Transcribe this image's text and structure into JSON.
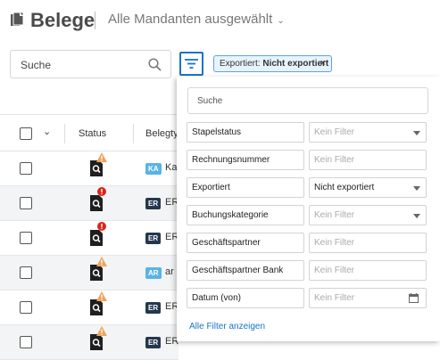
{
  "header": {
    "title": "Belege",
    "mandant_selector": "Alle Mandanten ausgewählt"
  },
  "toolbar": {
    "search_placeholder": "Suche",
    "active_filter_chip": {
      "label": "Exportiert:",
      "value": "Nicht exportiert",
      "remove": "×"
    }
  },
  "table": {
    "columns": [
      "Status",
      "Belegtyp"
    ],
    "rows": [
      {
        "status": "warning",
        "type_tag": "KA",
        "text": "Ka"
      },
      {
        "status": "error",
        "type_tag": "ER",
        "text": "ER"
      },
      {
        "status": "error",
        "type_tag": "ER",
        "text": "ER"
      },
      {
        "status": "warning",
        "type_tag": "AR",
        "text": "ar"
      },
      {
        "status": "warning",
        "type_tag": "ER",
        "text": "ER"
      },
      {
        "status": "warning",
        "type_tag": "ER",
        "text": "ER"
      }
    ]
  },
  "filter_panel": {
    "search_placeholder": "Suche",
    "filters": [
      {
        "label": "Stapelstatus",
        "value": "Kein Filter",
        "control": "dropdown",
        "active": false
      },
      {
        "label": "Rechnungsnummer",
        "value": "Kein Filter",
        "control": "text",
        "active": false
      },
      {
        "label": "Exportiert",
        "value": "Nicht exportiert",
        "control": "dropdown",
        "active": true
      },
      {
        "label": "Buchungskategorie",
        "value": "Kein Filter",
        "control": "dropdown",
        "active": false
      },
      {
        "label": "Geschäftspartner",
        "value": "Kein Filter",
        "control": "text",
        "active": false
      },
      {
        "label": "Geschäftspartner Bank",
        "value": "Kein Filter",
        "control": "text",
        "active": false
      },
      {
        "label": "Datum (von)",
        "value": "Kein Filter",
        "control": "date",
        "active": false
      }
    ],
    "show_all_link": "Alle Filter anzeigen"
  },
  "colors": {
    "accent": "#1a73c9",
    "warning": "#f0a35a",
    "error": "#d9251d",
    "tag_light": "#5ab3e8",
    "tag_dark": "#24374e"
  }
}
